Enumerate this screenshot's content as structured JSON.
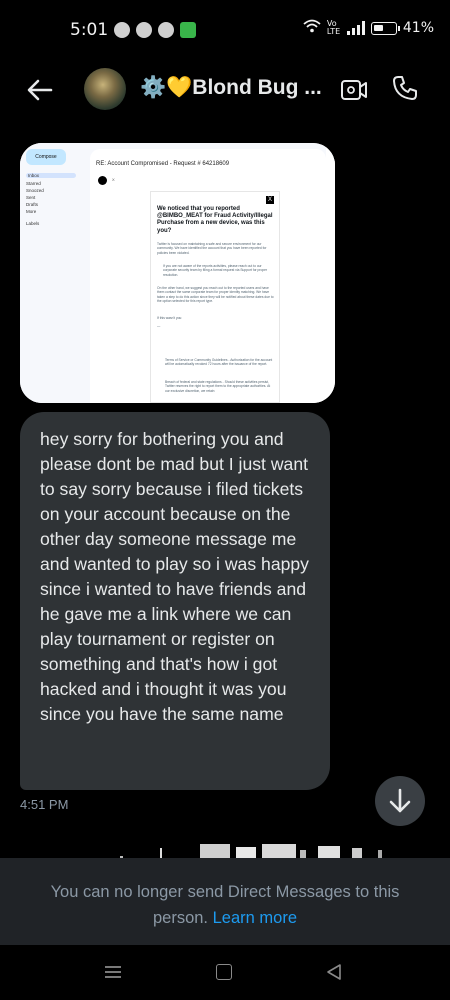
{
  "status_bar": {
    "time": "5:01",
    "battery": "41%",
    "network": "Vo LTE"
  },
  "header": {
    "title": "⚙️💛Blond Bug ...",
    "icons": [
      "back-arrow-icon",
      "video-icon",
      "phone-icon"
    ]
  },
  "shared_image": {
    "compose_label": "Compose",
    "nav": [
      "Inbox",
      "Starred",
      "Snoozed",
      "Sent",
      "Drafts",
      "More"
    ],
    "labels_heading": "Labels",
    "subject": "RE: Account Compromised - Request # 64218609",
    "heading": "We noticed that you reported @BIMBO_MEAT for Fraud Activity/Illegal Purchase from a new device, was this you?",
    "paragraphs": [
      "Twitter is focused on maintaining a safe and secure environment for our community. We have identified the account that you have been reported for policies been violated.",
      "If you are not aware of the reports activities, please reach out to our corporate security team by filing a formal request via Support for proper resolution.",
      "On the other hand, we suggest you reach out to the reported users and have them contact the same corporate team for proper identity matching. We have taken a step to do this action since they will be notified about these dates due to the option selected for this report type.",
      "If this wasn't you:",
      "Terms of Service or Community Guidelines - Authorization for the account will be automatically revoked 72 hours after the issuance of the report.",
      "Breach of federal and state regulations - Should these activities persist, Twitter reserves the right to report them to the appropriate authorities. At our exclusive discretion, we retain"
    ]
  },
  "message": {
    "text": "hey sorry for bothering you and please dont be mad but I just want to say sorry because i filed tickets on your account because on the other day someone message me and wanted to play so i was happy since i wanted to have friends and he gave me a link where we can play tournament or register on something and that's how i got hacked and i thought it was you since you have the same name",
    "time": "4:51 PM"
  },
  "notice": {
    "text": "You can no longer send Direct Messages to this person.",
    "link": "Learn more"
  },
  "nav_icons": [
    "recents-icon",
    "home-icon",
    "back-icon"
  ]
}
